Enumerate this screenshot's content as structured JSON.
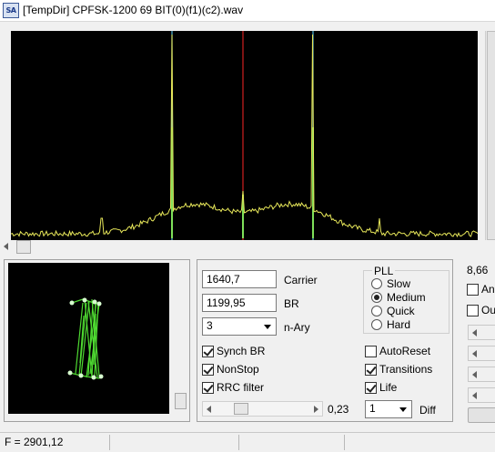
{
  "window": {
    "icon_text": "SA",
    "title": "[TempDir] CPFSK-1200 69 BIT(0)(f1)(c2).wav"
  },
  "spectrum": {
    "colors": {
      "trace": "#e8e85a",
      "center_marker": "#d02020",
      "side_markers": "#4fb3d8",
      "peak_fill": "#7ee05a"
    }
  },
  "controls": {
    "carrier_value": "1640,7",
    "carrier_label": "Carrier",
    "br_value": "1199,95",
    "br_label": "BR",
    "nary_value": "3",
    "nary_label": "n-Ary",
    "pll": {
      "title": "PLL",
      "options": [
        {
          "label": "Slow",
          "selected": false
        },
        {
          "label": "Medium",
          "selected": true
        },
        {
          "label": "Quick",
          "selected": false
        },
        {
          "label": "Hard",
          "selected": false
        }
      ]
    },
    "checks_left": [
      {
        "label": "Synch BR",
        "checked": true
      },
      {
        "label": "NonStop",
        "checked": true
      },
      {
        "label": "RRC filter",
        "checked": true
      }
    ],
    "checks_right": [
      {
        "label": "AutoReset",
        "checked": false
      },
      {
        "label": "Transitions",
        "checked": true
      },
      {
        "label": "Life",
        "checked": true
      }
    ],
    "rrc_value": "0,23",
    "diff_value": "1",
    "diff_label": "Diff"
  },
  "right_column": {
    "value": "8,66",
    "check1_label": "An",
    "check2_label": "Ou"
  },
  "status": {
    "frequency": "F = 2901,12"
  }
}
